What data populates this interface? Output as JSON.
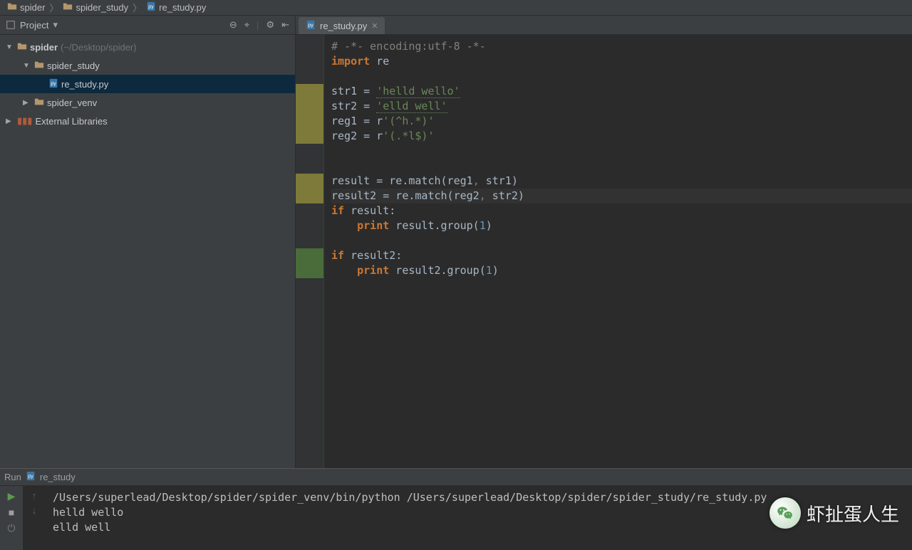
{
  "breadcrumbs": [
    {
      "kind": "folder",
      "label": "spider"
    },
    {
      "kind": "folder",
      "label": "spider_study"
    },
    {
      "kind": "pyfile",
      "label": "re_study.py"
    }
  ],
  "sidebar": {
    "title": "Project",
    "tree": {
      "root": {
        "label": "spider",
        "path": "(~/Desktop/spider)"
      },
      "child1": {
        "label": "spider_study"
      },
      "file": {
        "label": "re_study.py"
      },
      "child2": {
        "label": "spider_venv"
      },
      "libs": {
        "label": "External Libraries"
      }
    }
  },
  "tabs": [
    {
      "label": "re_study.py",
      "active": true
    }
  ],
  "code": {
    "l1": "# -*- encoding:utf-8 -*-",
    "l2a": "import",
    "l2b": " re",
    "l3": "",
    "l4a": "str1 = ",
    "l4b": "'helld wello'",
    "l5a": "str2 = ",
    "l5b": "'elld well'",
    "l6a": "reg1 = r",
    "l6b": "'(^h.*)'",
    "l7a": "reg2 = r",
    "l7b": "'(.*l$)'",
    "l8": "",
    "l9": "",
    "l10a": "result = re.match(reg1",
    "l10b": ", ",
    "l10c": "str1)",
    "l11a": "result2 = re.match(reg2",
    "l11b": ", ",
    "l11c": "str2)",
    "l12a": "if",
    "l12b": " result:",
    "l13a": "    ",
    "l13b": "print",
    "l13c": " result.group(",
    "l13d": "1",
    "l13e": ")",
    "l14": "",
    "l15a": "if",
    "l15b": " result2:",
    "l16a": "    ",
    "l16b": "print",
    "l16c": " result2.group(",
    "l16d": "1",
    "l16e": ")"
  },
  "run": {
    "label": "Run",
    "config": "re_study",
    "console": [
      "/Users/superlead/Desktop/spider/spider_venv/bin/python /Users/superlead/Desktop/spider/spider_study/re_study.py",
      "helld wello",
      "elld well"
    ]
  },
  "watermark": "虾扯蛋人生"
}
